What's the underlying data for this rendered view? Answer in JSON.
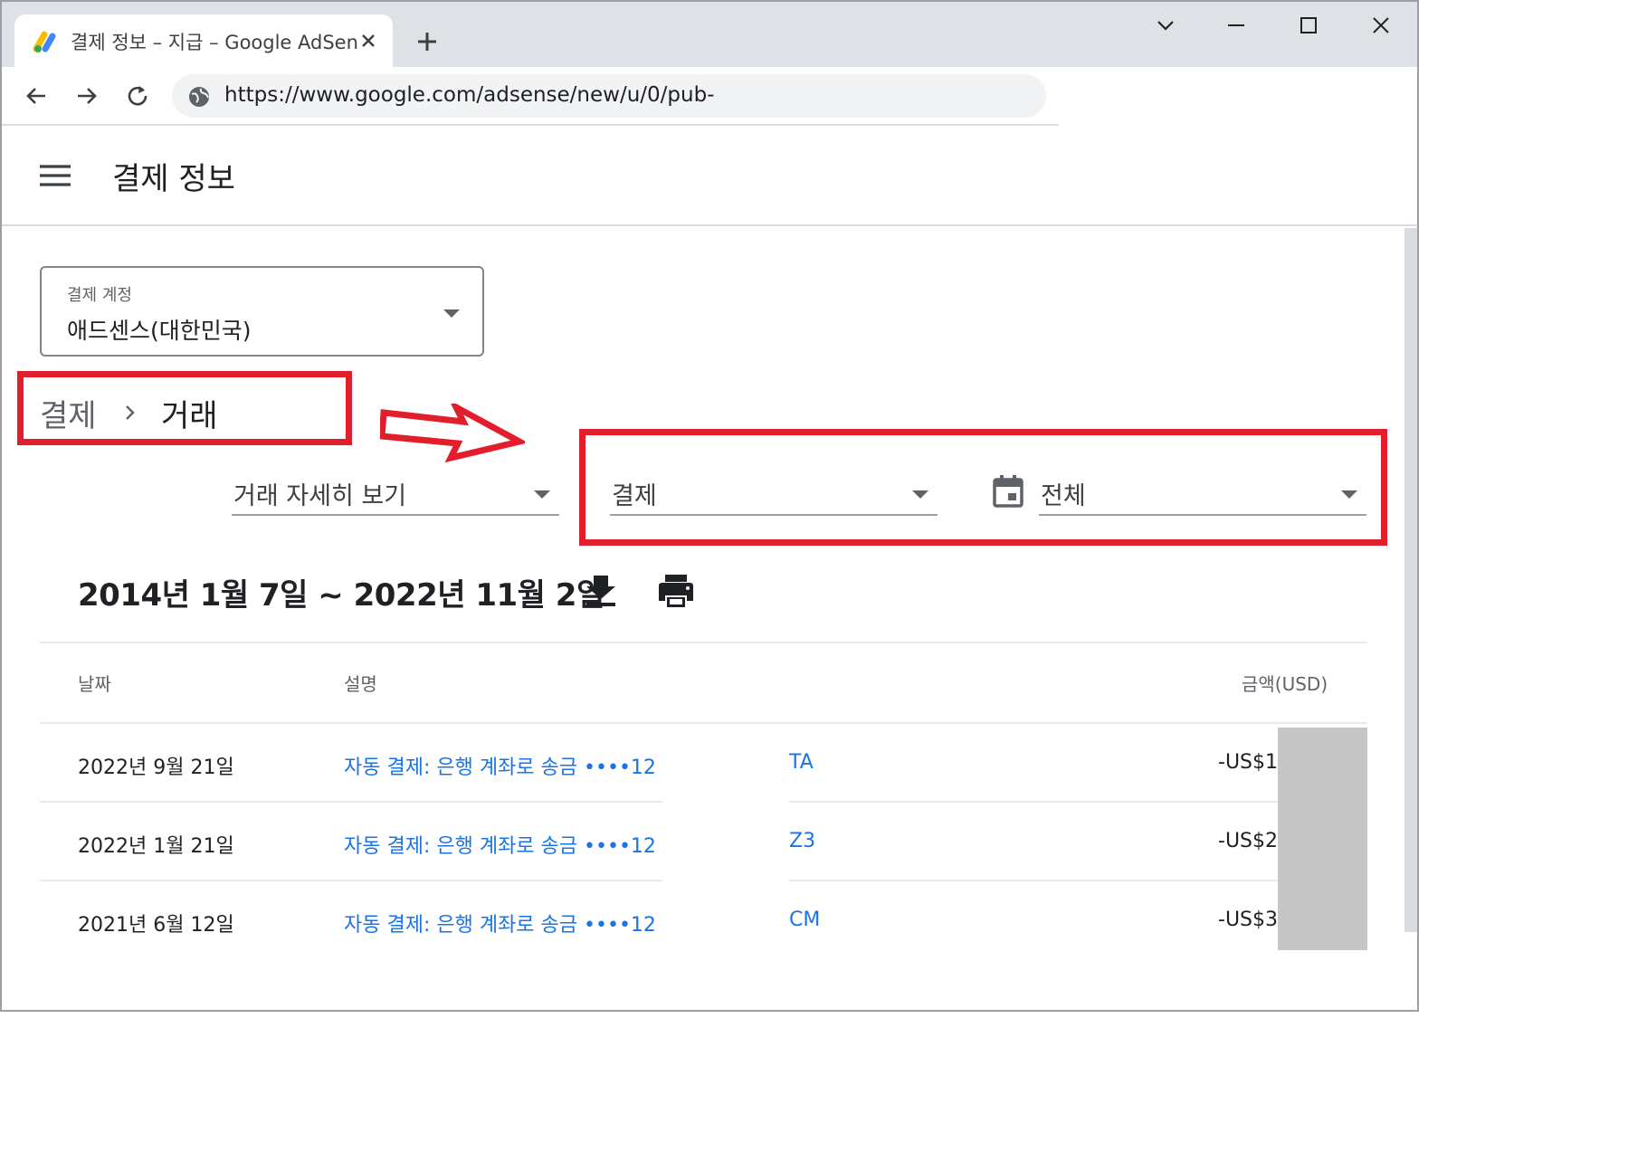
{
  "browser": {
    "tab_title": "결제 정보 – 지급 – Google AdSense",
    "url": "https://www.google.com/adsense/new/u/0/pub-"
  },
  "header": {
    "page_title": "결제 정보"
  },
  "account_selector": {
    "label": "결제 계정",
    "value": "애드센스(대한민국)"
  },
  "breadcrumb": {
    "parent": "결제",
    "current": "거래"
  },
  "filters": {
    "view": "거래 자세히 보기",
    "type": "결제",
    "period": "전체"
  },
  "date_range": "2014년 1월 7일 ~ 2022년 11월 2일",
  "table": {
    "headers": {
      "date": "날짜",
      "description": "설명",
      "amount": "금액(USD)"
    },
    "rows": [
      {
        "date": "2022년 9월 21일",
        "description": "자동 결제: 은행 계좌로 송금 ••••12",
        "tail": "TA",
        "amount": "-US$1"
      },
      {
        "date": "2022년 1월 21일",
        "description": "자동 결제: 은행 계좌로 송금 ••••12",
        "tail": "Z3",
        "amount": "-US$2"
      },
      {
        "date": "2021년 6월 12일",
        "description": "자동 결제: 은행 계좌로 송금 ••••12",
        "tail": "CM",
        "amount": "-US$3"
      }
    ]
  },
  "colors": {
    "annotation_red": "#e31e2c",
    "link_blue": "#1a73e8",
    "redaction_gray": "#c6c6c6"
  },
  "icons": [
    "adsense-favicon",
    "close-icon",
    "plus-icon",
    "chevron-down-icon",
    "minimize-icon",
    "maximize-icon",
    "back-icon",
    "forward-icon",
    "reload-icon",
    "site-info-icon",
    "menu-icon",
    "calendar-icon",
    "download-icon",
    "print-icon"
  ]
}
